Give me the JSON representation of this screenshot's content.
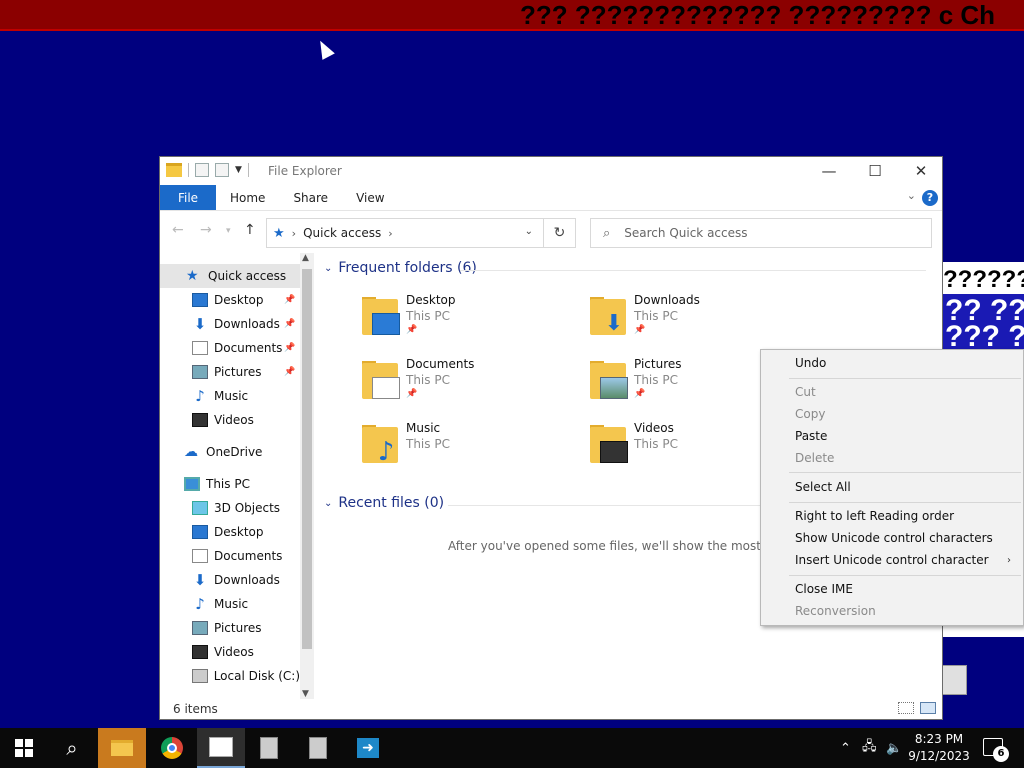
{
  "banner": {
    "text": "??? ????????????? ????????? c Ch"
  },
  "background_window": {
    "row1": "??????",
    "row2": "?? ??",
    "row3": "??? ??"
  },
  "explorer": {
    "title": "File Explorer",
    "ribbon_tabs": [
      "File",
      "Home",
      "Share",
      "View"
    ],
    "help": "?",
    "address": {
      "root_icon": "quick-access-star-icon",
      "path": "Quick access"
    },
    "search": {
      "placeholder": "Search Quick access"
    },
    "nav_pane": {
      "quick_access": "Quick access",
      "pinned": [
        "Desktop",
        "Downloads",
        "Documents",
        "Pictures"
      ],
      "unpinned": [
        "Music",
        "Videos"
      ],
      "onedrive": "OneDrive",
      "this_pc": "This PC",
      "this_pc_items": [
        "3D Objects",
        "Desktop",
        "Documents",
        "Downloads",
        "Music",
        "Pictures",
        "Videos",
        "Local Disk (C:)"
      ]
    },
    "frequent_header": "Frequent folders (6)",
    "recent_header": "Recent files (0)",
    "folders": [
      {
        "name": "Desktop",
        "location": "This PC",
        "pinned": true
      },
      {
        "name": "Downloads",
        "location": "This PC",
        "pinned": true
      },
      {
        "name": "Documents",
        "location": "This PC",
        "pinned": true
      },
      {
        "name": "Pictures",
        "location": "This PC",
        "pinned": true
      },
      {
        "name": "Music",
        "location": "This PC",
        "pinned": false
      },
      {
        "name": "Videos",
        "location": "This PC",
        "pinned": false
      }
    ],
    "empty_message": "After you've opened some files, we'll show the most recent",
    "status": "6 items"
  },
  "context_menu": {
    "undo": "Undo",
    "cut": "Cut",
    "copy": "Copy",
    "paste": "Paste",
    "delete": "Delete",
    "select_all": "Select All",
    "rtl": "Right to left Reading order",
    "show_unicode": "Show Unicode control characters",
    "insert_unicode": "Insert Unicode control character",
    "close_ime": "Close IME",
    "reconversion": "Reconversion"
  },
  "taskbar": {
    "time": "8:23 PM",
    "date": "9/12/2023",
    "notification_count": "6"
  }
}
